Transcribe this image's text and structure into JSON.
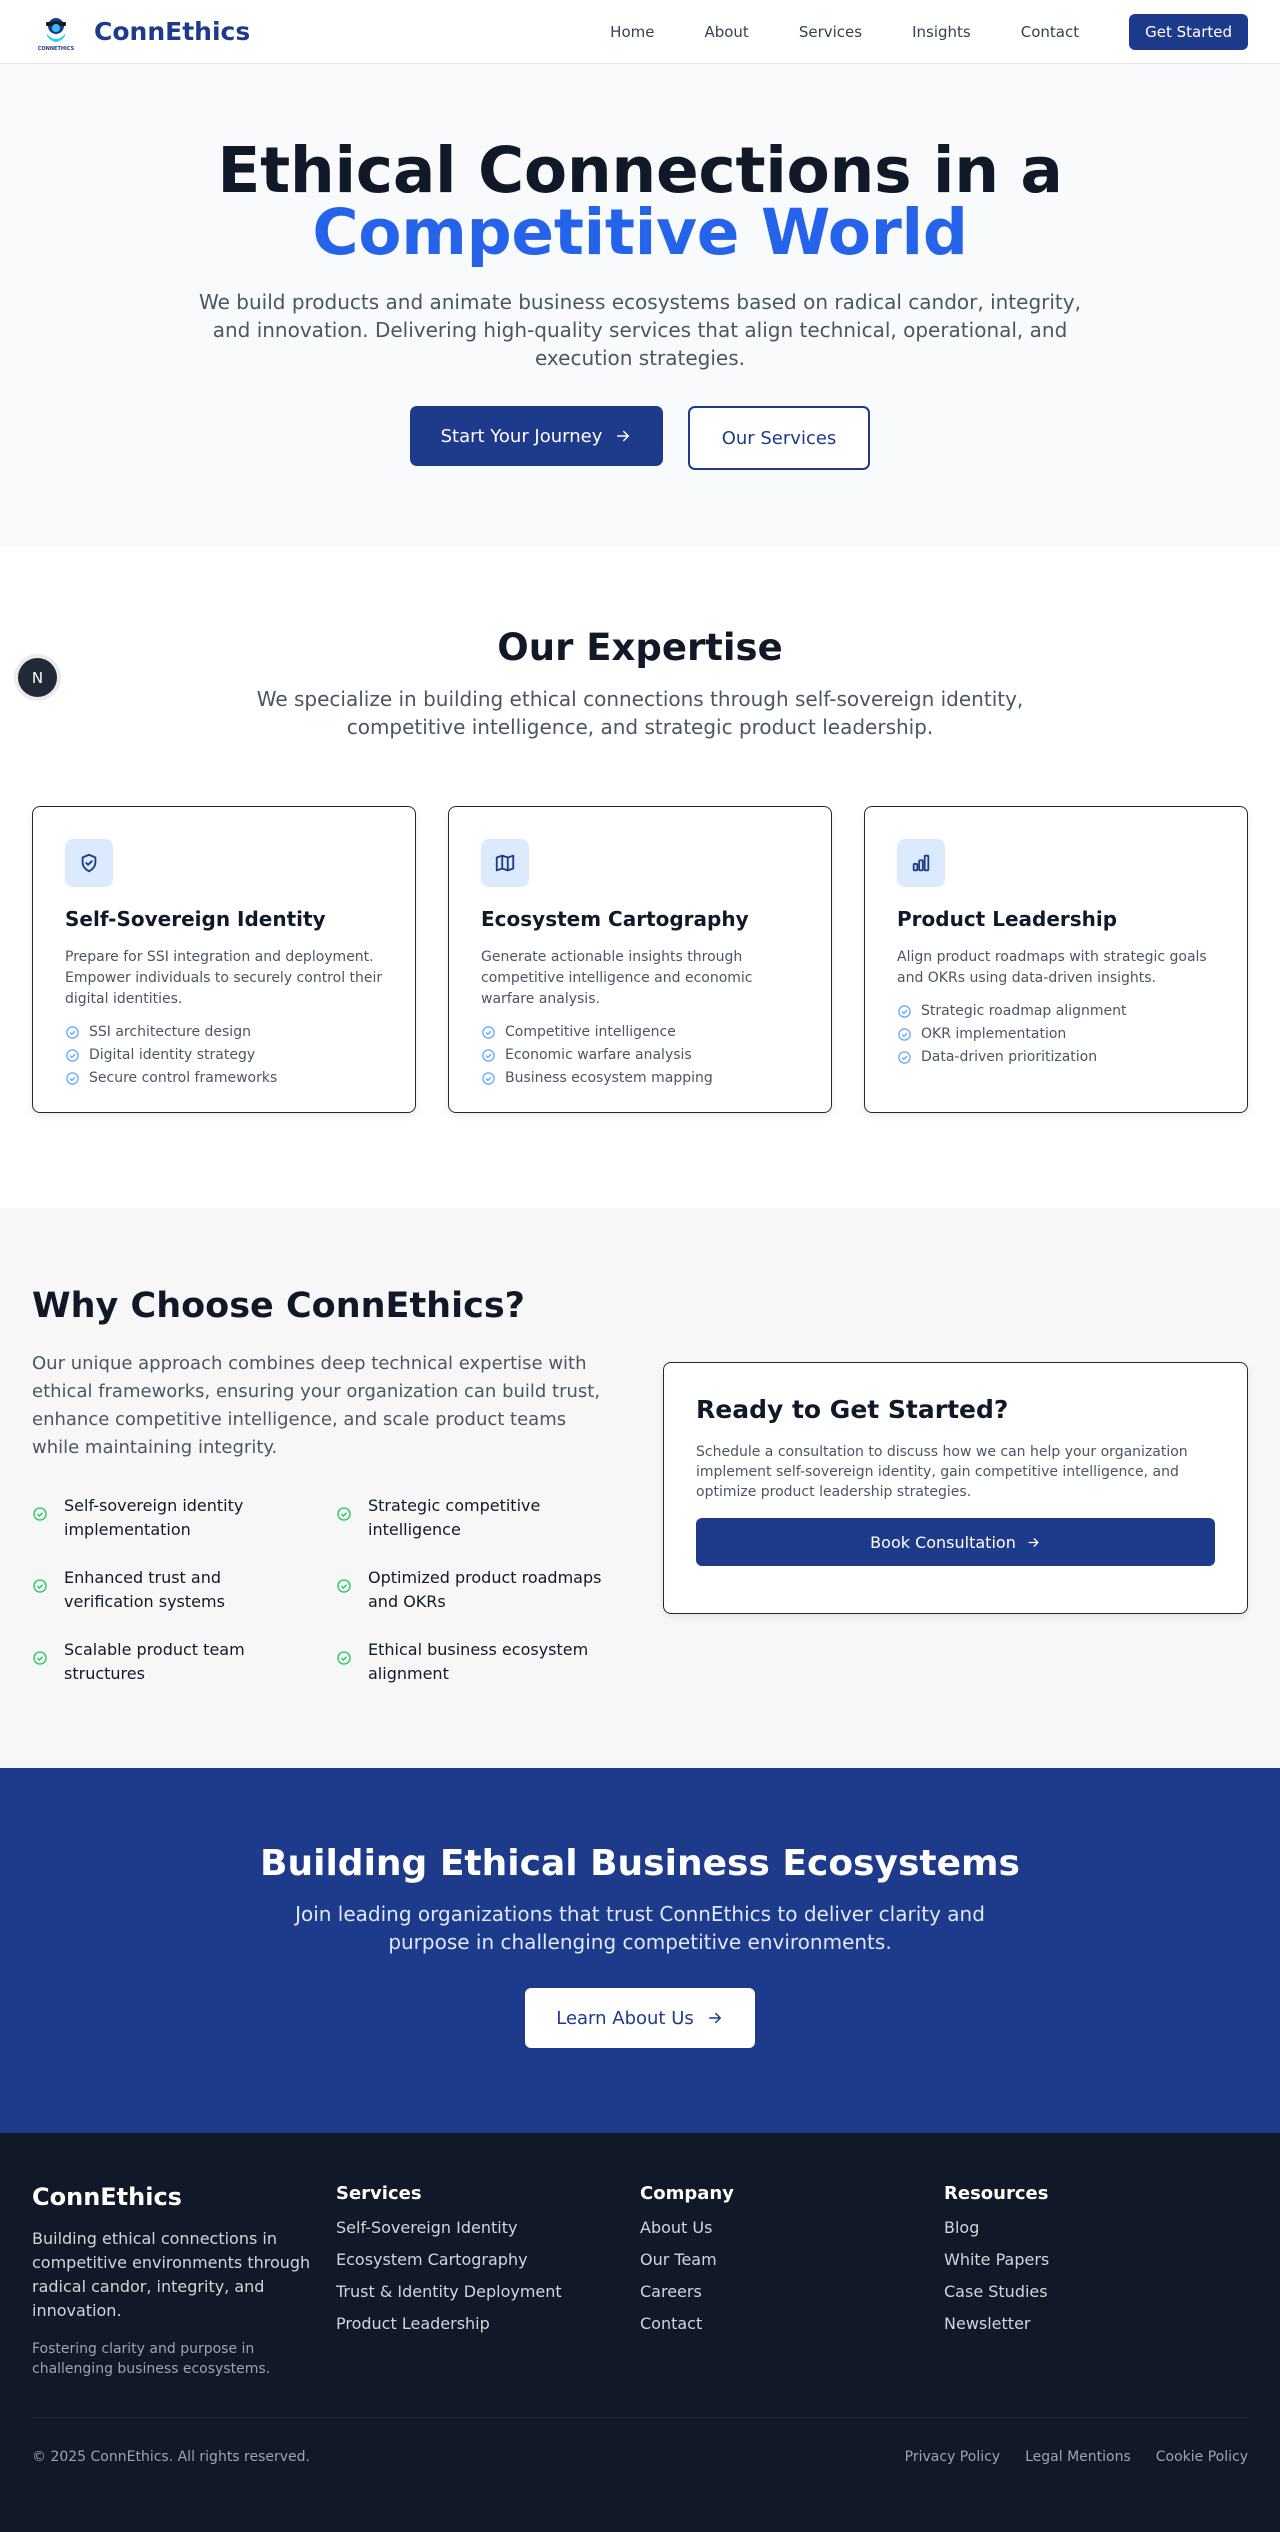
{
  "nav": {
    "brand": "ConnEthics",
    "links": [
      "Home",
      "About",
      "Services",
      "Insights",
      "Contact"
    ],
    "cta": "Get Started"
  },
  "hero": {
    "title_main": "Ethical Connections in a ",
    "title_accent": "Competitive World",
    "subtitle": "We build products and animate business ecosystems based on radical candor, integrity, and innovation. Delivering high-quality services that align technical, operational, and execution strategies.",
    "primary_button": "Start Your Journey",
    "secondary_button": "Our Services"
  },
  "floating_badge": "N",
  "expertise": {
    "title": "Our Expertise",
    "subtitle": "We specialize in building ethical connections through self-sovereign identity, competitive intelligence, and strategic product leadership.",
    "cards": [
      {
        "icon": "shield-check-icon",
        "title": "Self-Sovereign Identity",
        "description": "Prepare for SSI integration and deployment. Empower individuals to securely control their digital identities.",
        "features": [
          "SSI architecture design",
          "Digital identity strategy",
          "Secure control frameworks"
        ]
      },
      {
        "icon": "map-icon",
        "title": "Ecosystem Cartography",
        "description": "Generate actionable insights through competitive intelligence and economic warfare analysis.",
        "features": [
          "Competitive intelligence",
          "Economic warfare analysis",
          "Business ecosystem mapping"
        ]
      },
      {
        "icon": "bar-chart-icon",
        "title": "Product Leadership",
        "description": "Align product roadmaps with strategic goals and OKRs using data-driven insights.",
        "features": [
          "Strategic roadmap alignment",
          "OKR implementation",
          "Data-driven prioritization"
        ]
      }
    ]
  },
  "why": {
    "title": "Why Choose ConnEthics?",
    "description": "Our unique approach combines deep technical expertise with ethical frameworks, ensuring your organization can build trust, enhance competitive intelligence, and scale product teams while maintaining integrity.",
    "items": [
      "Self-sovereign identity implementation",
      "Strategic competitive intelligence",
      "Enhanced trust and verification systems",
      "Optimized product roadmaps and OKRs",
      "Scalable product team structures",
      "Ethical business ecosystem alignment"
    ],
    "ready_title": "Ready to Get Started?",
    "ready_desc": "Schedule a consultation to discuss how we can help your organization implement self-sovereign identity, gain competitive intelligence, and optimize product leadership strategies.",
    "ready_button": "Book Consultation"
  },
  "cta": {
    "title": "Building Ethical Business Ecosystems",
    "subtitle": "Join leading organizations that trust ConnEthics to deliver clarity and purpose in challenging competitive environments.",
    "button": "Learn About Us"
  },
  "footer": {
    "brand": "ConnEthics",
    "brand_desc": "Building ethical connections in competitive environments through radical candor, integrity, and innovation.",
    "brand_tag": "Fostering clarity and purpose in challenging business ecosystems.",
    "columns": [
      {
        "heading": "Services",
        "links": [
          "Self-Sovereign Identity",
          "Ecosystem Cartography",
          "Trust & Identity Deployment",
          "Product Leadership"
        ]
      },
      {
        "heading": "Company",
        "links": [
          "About Us",
          "Our Team",
          "Careers",
          "Contact"
        ]
      },
      {
        "heading": "Resources",
        "links": [
          "Blog",
          "White Papers",
          "Case Studies",
          "Newsletter"
        ]
      }
    ],
    "copyright": "© 2025 ConnEthics. All rights reserved.",
    "legal": [
      "Privacy Policy",
      "Legal Mentions",
      "Cookie Policy"
    ]
  },
  "colors": {
    "brand_navy": "#1e3a8a",
    "accent_blue": "#2563eb",
    "check_green": "#22c55e",
    "footer_bg": "#111827"
  }
}
